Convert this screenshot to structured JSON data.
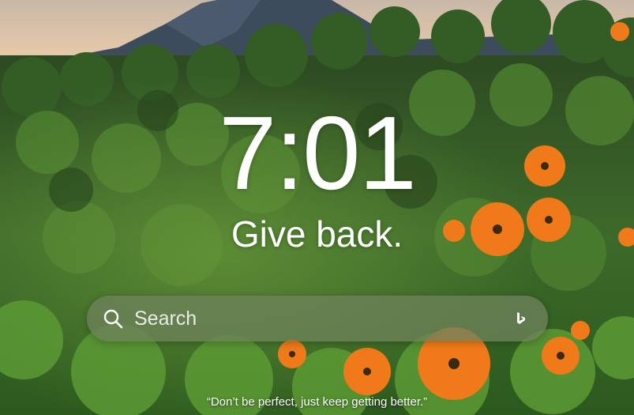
{
  "clock": {
    "time": "7:01"
  },
  "greeting": {
    "text": "Give back."
  },
  "search": {
    "placeholder": "Search",
    "value": ""
  },
  "quote": {
    "text": "“Don’t be perfect, just keep getting better.”"
  },
  "icons": {
    "search": "search-icon",
    "bing": "bing-logo-icon"
  },
  "colors": {
    "text": "#ffffff",
    "search_bar": "#6e825a",
    "flower": "#f07a1a"
  }
}
